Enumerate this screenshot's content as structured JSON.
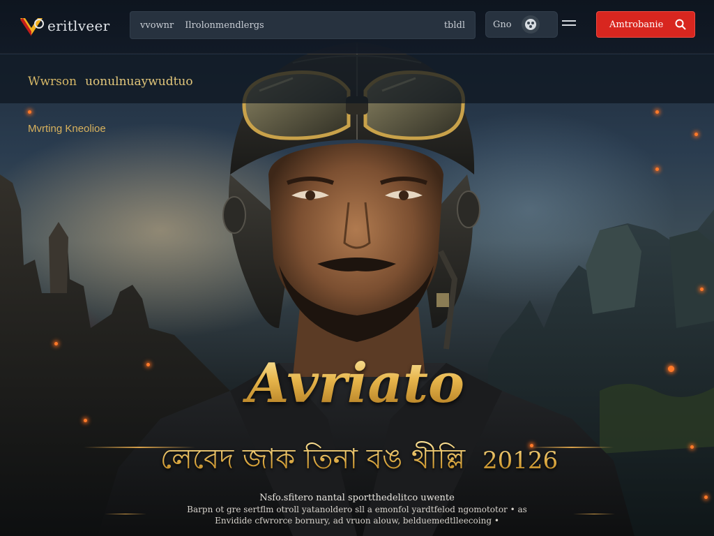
{
  "header": {
    "logo_text": "eritlveer",
    "search": {
      "prefix": "vvownr",
      "value": "Ilrolonmendlergs",
      "suffix": "tbldl"
    },
    "user_chip_label": "Gno",
    "cta_label": "Amtrobanie"
  },
  "subbar": {
    "lead": "Wwrson",
    "text": "uonulnuaywudtuo"
  },
  "status_text": "Mvrting Kneolioe",
  "hero": {
    "title": "Avriato",
    "subtitle": "লেবেদ জাক তিনা বঙ থীল্লি",
    "year": "20126"
  },
  "credits": {
    "line1": "Nsfo.sfitero nantal sportthedelitco uwente",
    "line2": "Barpn ot gre sertflm otroll yatanoldero sll a emonfol yardtfelod ngomototor • as",
    "line3": "Envidide cfwrorce bornury, ad vruon alouw, belduemedtlleecoing •"
  },
  "colors": {
    "cta": "#d8261f",
    "gold": "#e6b44a",
    "header_bg": "#0d141e"
  },
  "icons": [
    "logo-mark-icon",
    "search-icon",
    "avatar-icon",
    "menu-icon"
  ]
}
